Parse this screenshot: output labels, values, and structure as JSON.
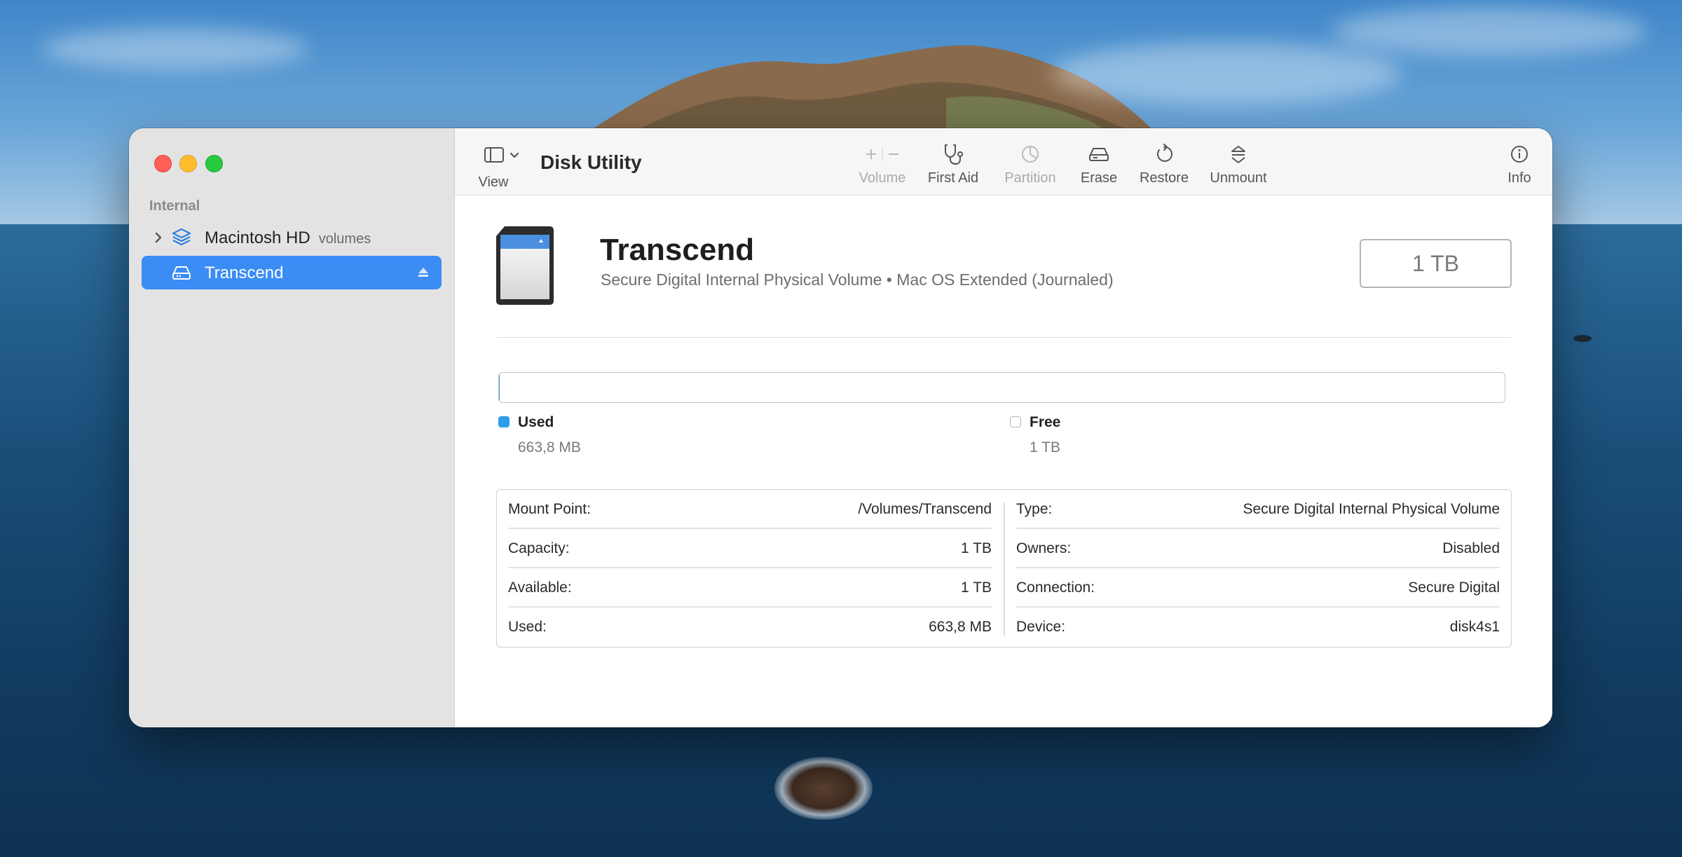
{
  "app": {
    "title": "Disk Utility"
  },
  "sidebar": {
    "section_label": "Internal",
    "items": [
      {
        "name": "Macintosh HD",
        "subtitle": "volumes",
        "icon": "layers-icon",
        "selected": false
      },
      {
        "name": "Transcend",
        "subtitle": "",
        "icon": "drive-icon",
        "selected": true
      }
    ]
  },
  "toolbar": {
    "view_label": "View",
    "volume_label": "Volume",
    "first_aid_label": "First Aid",
    "partition_label": "Partition",
    "erase_label": "Erase",
    "restore_label": "Restore",
    "unmount_label": "Unmount",
    "info_label": "Info"
  },
  "volume": {
    "name": "Transcend",
    "description": "Secure Digital Internal Physical Volume • Mac OS Extended (Journaled)",
    "capacity_badge": "1 TB"
  },
  "usage": {
    "used_fraction": 0.0007,
    "used_label": "Used",
    "used_value": "663,8 MB",
    "free_label": "Free",
    "free_value": "1 TB",
    "used_color": "#2f9de9"
  },
  "info": {
    "left": [
      {
        "key": "Mount Point:",
        "value": "/Volumes/Transcend"
      },
      {
        "key": "Capacity:",
        "value": "1 TB"
      },
      {
        "key": "Available:",
        "value": "1 TB"
      },
      {
        "key": "Used:",
        "value": "663,8 MB"
      }
    ],
    "right": [
      {
        "key": "Type:",
        "value": "Secure Digital Internal Physical Volume"
      },
      {
        "key": "Owners:",
        "value": "Disabled"
      },
      {
        "key": "Connection:",
        "value": "Secure Digital"
      },
      {
        "key": "Device:",
        "value": "disk4s1"
      }
    ]
  },
  "colors": {
    "accent": "#3b8cf5",
    "close": "#ff5f57",
    "minimize": "#febc2e",
    "maximize": "#28c840"
  }
}
